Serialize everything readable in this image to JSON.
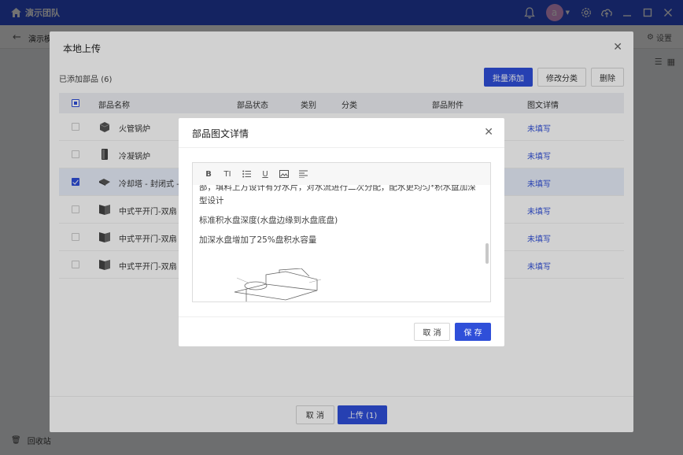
{
  "app": {
    "team_name": "演示团队",
    "avatar_letter": "a",
    "brand_color": "#2f4fd9"
  },
  "subbar": {
    "title": "演示模",
    "settings_label": "设置"
  },
  "sidebar": {
    "recycle_label": "回收站"
  },
  "upload_dialog": {
    "title": "本地上传",
    "added_label": "已添加部品",
    "added_count": "(6)",
    "batch_add": "批量添加",
    "modify_category": "修改分类",
    "delete": "删除",
    "columns": [
      "部品名称",
      "部品状态",
      "类别",
      "分类",
      "部品附件",
      "图文详情"
    ],
    "rows": [
      {
        "name": "火管锅炉",
        "detail": "未填写",
        "selected": false
      },
      {
        "name": "冷凝锅炉",
        "detail": "未填写",
        "selected": false
      },
      {
        "name": "冷却塔 - 封闭式 -",
        "detail": "未填写",
        "selected": true
      },
      {
        "name": "中式平开门-双扇",
        "detail": "未填写",
        "selected": false
      },
      {
        "name": "中式平开门-双扇",
        "detail": "未填写",
        "selected": false
      },
      {
        "name": "中式平开门-双扇",
        "detail": "未填写",
        "selected": false
      }
    ],
    "cancel": "取 消",
    "upload": "上传 (1)"
  },
  "detail_dialog": {
    "title": "部品图文详情",
    "toolbar": [
      "bold-icon",
      "text-size-icon",
      "list-icon",
      "underline-icon",
      "image-icon",
      "align-icon"
    ],
    "content": {
      "para1": "部，填料上方设计有分水片，对水流进行二次分配，配水更均匀*积水盘加深型设计",
      "para2": "标准积水盘深度(水盘边缘到水盘底盘)",
      "para3": "加深水盘增加了25%盘积水容量"
    },
    "cancel": "取 消",
    "save": "保 存"
  }
}
